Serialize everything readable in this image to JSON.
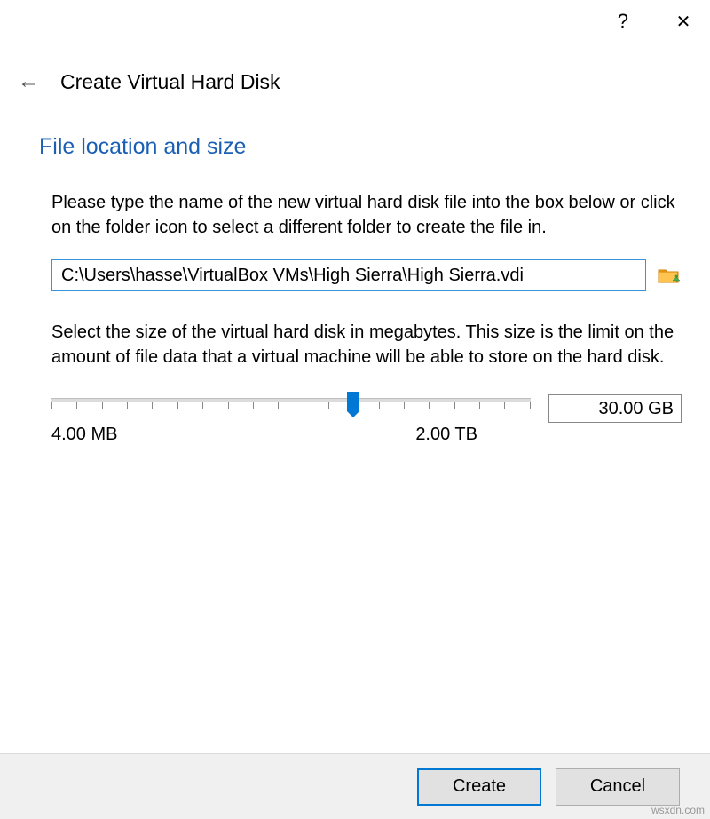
{
  "titlebar": {
    "help": "?",
    "close": "✕"
  },
  "header": {
    "back_arrow": "←",
    "title": "Create Virtual Hard Disk"
  },
  "section": {
    "title": "File location and size",
    "desc1": "Please type the name of the new virtual hard disk file into the box below or click on the folder icon to select a different folder to create the file in.",
    "file_path": "C:\\Users\\hasse\\VirtualBox VMs\\High Sierra\\High Sierra.vdi",
    "desc2": "Select the size of the virtual hard disk in megabytes. This size is the limit on the amount of file data that a virtual machine will be able to store on the hard disk.",
    "size_value": "30.00 GB",
    "slider_min": "4.00 MB",
    "slider_max": "2.00 TB"
  },
  "buttons": {
    "create": "Create",
    "cancel": "Cancel"
  },
  "watermark": "wsxdn.com"
}
